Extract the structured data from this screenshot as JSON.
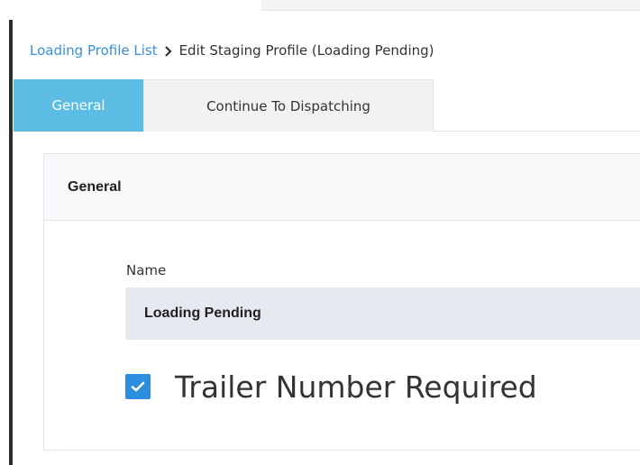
{
  "breadcrumb": {
    "parent": "Loading Profile List",
    "separator_icon": "chevron-right-icon",
    "current": "Edit Staging Profile (Loading Pending)"
  },
  "tabs": [
    {
      "label": "General",
      "active": true
    },
    {
      "label": "Continue To Dispatching",
      "active": false
    }
  ],
  "panel": {
    "title": "General",
    "name_field": {
      "label": "Name",
      "value": "Loading Pending"
    },
    "trailer_checkbox": {
      "label": "Trailer Number Required",
      "checked": true
    }
  },
  "colors": {
    "active_tab": "#5bbde4",
    "link": "#3a8fd9",
    "checkbox": "#2d8ee0",
    "input_bg": "#e6e9ef"
  }
}
